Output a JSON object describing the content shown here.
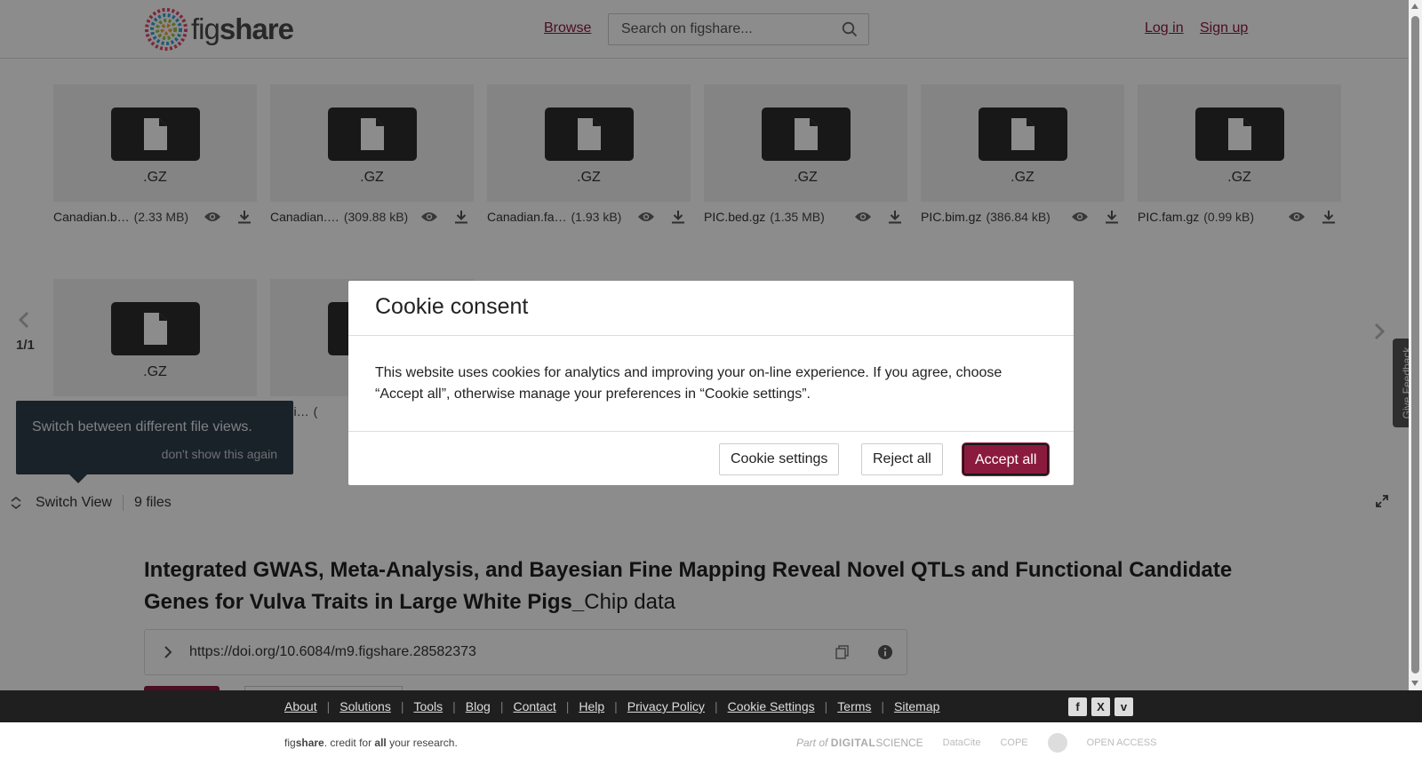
{
  "header": {
    "logo_text_light": "fig",
    "logo_text_bold": "share",
    "browse": "Browse",
    "search_placeholder": "Search on figshare...",
    "login": "Log in",
    "signup": "Sign up"
  },
  "files": [
    {
      "ext": ".GZ",
      "name": "Canadian.b…",
      "size": "(2.33 MB)"
    },
    {
      "ext": ".GZ",
      "name": "Canadian.…",
      "size": "(309.88 kB)"
    },
    {
      "ext": ".GZ",
      "name": "Canadian.fa…",
      "size": "(1.93 kB)"
    },
    {
      "ext": ".GZ",
      "name": "PIC.bed.gz",
      "size": "(1.35 MB)"
    },
    {
      "ext": ".GZ",
      "name": "PIC.bim.gz",
      "size": "(386.84 kB)"
    },
    {
      "ext": ".GZ",
      "name": "PIC.fam.gz",
      "size": "(0.99 kB)"
    },
    {
      "ext": ".GZ",
      "name": "",
      "size": ""
    },
    {
      "ext": "",
      "name": "gs.bi…",
      "size": "("
    }
  ],
  "viewer": {
    "pager": "1/1",
    "tooltip_text": "Switch between different file views.",
    "tooltip_dismiss": "don't show this again",
    "switch_view": "Switch View",
    "file_count": "9 files",
    "feedback": "Give Feedback"
  },
  "article": {
    "title_bold": "Integrated GWAS, Meta-Analysis, and Bayesian Fine Mapping Reveal Novel QTLs and Functional Candidate Genes for Vulva Traits in Large White Pigs_",
    "title_normal": "Chip data",
    "doi": "https://doi.org/10.6084/m9.figshare.28582373"
  },
  "modal": {
    "title": "Cookie consent",
    "body": "This website uses cookies for analytics and improving your on-line experience. If you agree, choose “Accept all”, otherwise manage your preferences in “Cookie settings”.",
    "settings": "Cookie settings",
    "reject": "Reject all",
    "accept": "Accept all"
  },
  "footer": {
    "links": [
      "About",
      "Solutions",
      "Tools",
      "Blog",
      "Contact",
      "Help",
      "Privacy Policy",
      "Cookie Settings",
      "Terms",
      "Sitemap"
    ],
    "social": [
      "f",
      "X",
      "v"
    ],
    "credit_pre": "fig",
    "credit_bold1": "share",
    "credit_mid": ". credit for ",
    "credit_bold2": "all",
    "credit_post": " your research.",
    "partner_ds_pre": "Part of",
    "partner_ds_bold": "DIGITAL",
    "partner_ds_post": "SCIENCE",
    "partner_datacite": "DataCite",
    "partner_cope": "COPE",
    "partner_oa": "OPEN ACCESS"
  },
  "colors": {
    "brand": "#8b1a3f",
    "tooltip": "#2f3d4c",
    "footer": "#1f1f1f"
  }
}
